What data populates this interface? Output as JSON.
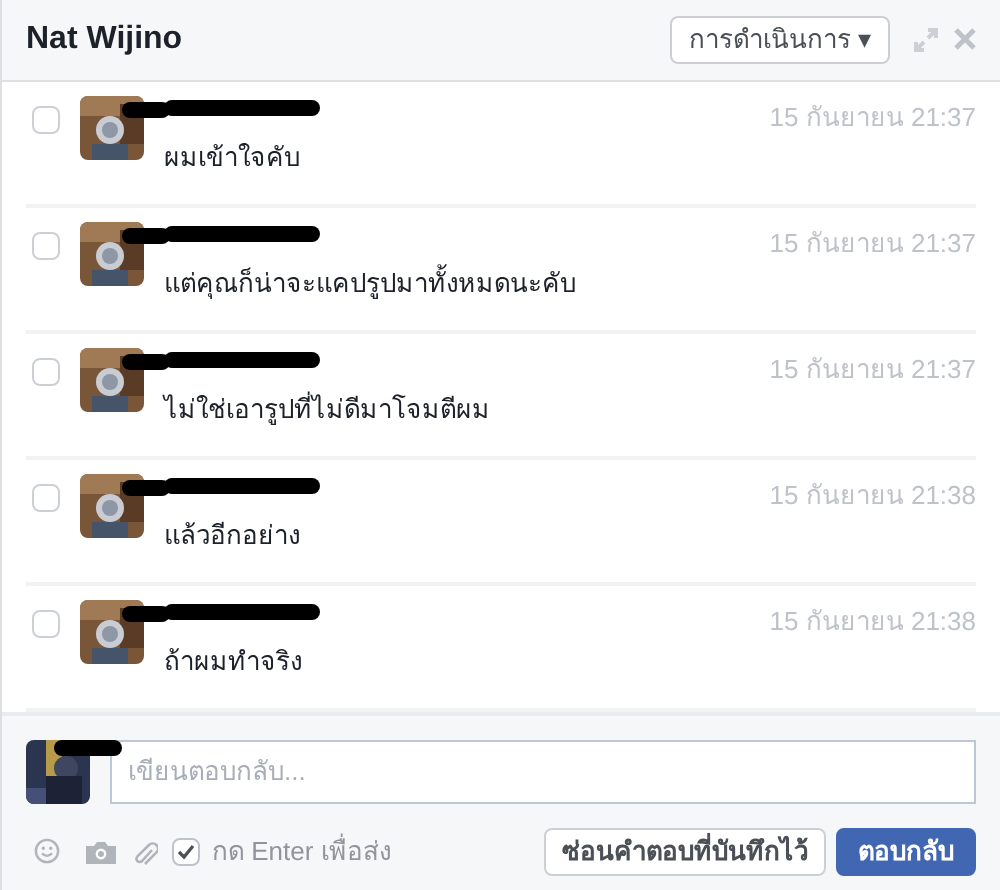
{
  "window": {
    "title": "Nat Wijino",
    "actions_button": "การดำเนินการ ▾"
  },
  "messages": [
    {
      "selected": false,
      "time": "15 กันยายน 21:37",
      "text": "ผมเข้าใจคับ"
    },
    {
      "selected": false,
      "time": "15 กันยายน 21:37",
      "text": "แต่คุณก็น่าจะแคปรูปมาทั้งหมดนะคับ"
    },
    {
      "selected": false,
      "time": "15 กันยายน 21:37",
      "text": "ไม่ใช่เอารูปที่ไม่ดีมาโจมตีผม"
    },
    {
      "selected": false,
      "time": "15 กันยายน 21:38",
      "text": "แล้วอีกอย่าง"
    },
    {
      "selected": false,
      "time": "15 กันยายน 21:38",
      "text": "ถ้าผมทำจริง"
    }
  ],
  "composer": {
    "placeholder": "เขียนตอบกลับ...",
    "enter_to_send": {
      "label": "กด Enter เพื่อส่ง",
      "checked": true
    },
    "buttons": [
      "ซ่อนคำตอบที่บันทึกไว้",
      "ตอบกลับ"
    ]
  }
}
